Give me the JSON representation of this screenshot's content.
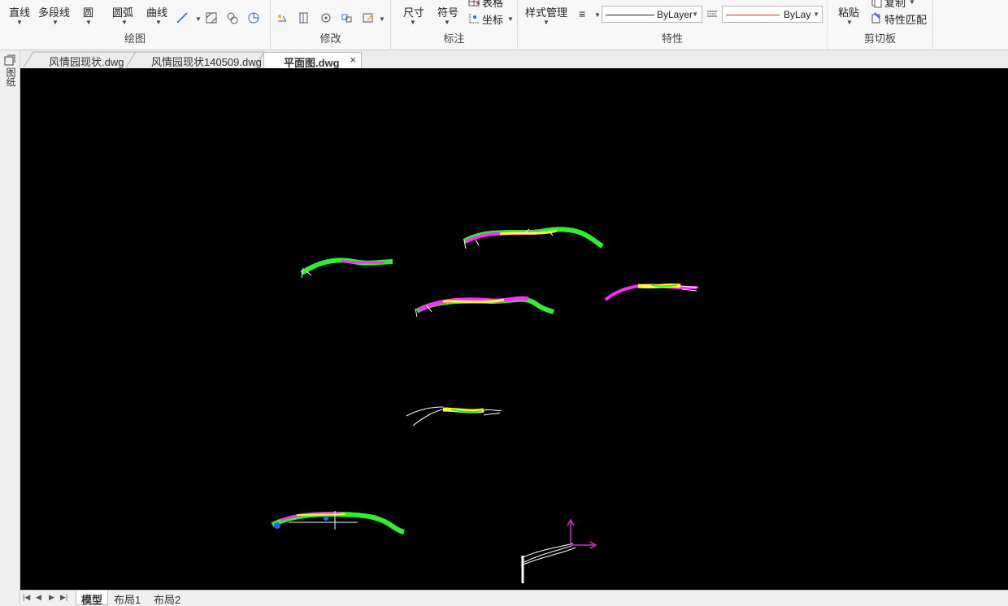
{
  "ribbon": {
    "draw": {
      "title": "绘图",
      "line": "直线",
      "polyline": "多段线",
      "circle": "圆",
      "arc": "圆弧",
      "curve": "曲线"
    },
    "modify": {
      "title": "修改"
    },
    "annotate": {
      "title": "标注",
      "dimension": "尺寸",
      "symbol": "符号",
      "table": "表格",
      "coordinate": "坐标"
    },
    "properties": {
      "title": "特性",
      "style_manager": "样式管理",
      "linetype": "ByLayer",
      "color": "ByLayer"
    },
    "clipboard": {
      "title": "剪切板",
      "paste": "粘贴",
      "copy": "复制",
      "match_properties": "特性匹配"
    }
  },
  "side_panel": {
    "label": "图纸"
  },
  "doc_tabs": [
    {
      "label": "风情园现状.dwg"
    },
    {
      "label": "风情园现状140509.dwg"
    },
    {
      "label": "平面图.dwg",
      "active": true,
      "close": "×"
    }
  ],
  "layout_tabs": [
    {
      "label": "模型",
      "active": true
    },
    {
      "label": "布局1"
    },
    {
      "label": "布局2"
    }
  ],
  "colors": {
    "canvas_bg": "#000000",
    "green": "#2ef02e",
    "magenta": "#ff2dff",
    "yellow": "#ffff33",
    "white": "#ffffff",
    "ucs": "#cc33cc",
    "color_line": "#e03030"
  }
}
